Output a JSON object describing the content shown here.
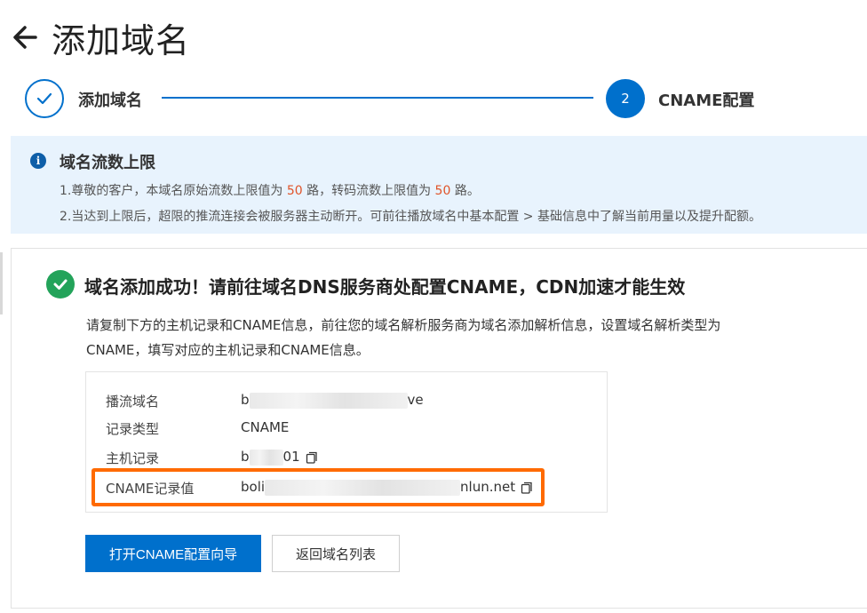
{
  "page": {
    "title": "添加域名"
  },
  "steps": [
    {
      "label": "添加域名",
      "status": "done"
    },
    {
      "number": "2",
      "label": "CNAME配置",
      "status": "active"
    }
  ],
  "notice": {
    "title": "域名流数上限",
    "line1": {
      "prefix": "1.尊敬的客户，本域名原始流数上限值为 ",
      "limit1": "50",
      "mid": " 路，转码流数上限值为 ",
      "limit2": "50",
      "suffix": " 路。"
    },
    "line2": "2.当达到上限后，超限的推流连接会被服务器主动断开。可前往播放域名中基本配置 > 基础信息中了解当前用量以及提升配额。"
  },
  "result": {
    "title": "域名添加成功！请前往域名DNS服务商处配置CNAME，CDN加速才能生效",
    "description": "请复制下方的主机记录和CNAME信息，前往您的域名解析服务商为域名添加解析信息，设置域名解析类型为CNAME，填写对应的主机记录和CNAME信息。",
    "rows": [
      {
        "label": "播流域名",
        "value_start": "b",
        "value_end": "ve"
      },
      {
        "label": "记录类型",
        "value": "CNAME"
      },
      {
        "label": "主机记录",
        "value_start": "b",
        "value_end": "01"
      },
      {
        "label": "CNAME记录值",
        "value_start": "boli",
        "value_end": "nlun.net"
      }
    ]
  },
  "buttons": {
    "primary": "打开CNAME配置向导",
    "secondary": "返回域名列表"
  },
  "colors": {
    "accent": "#0070cc",
    "success": "#23a35a",
    "limit": "#e0542a",
    "highlight_frame": "#ff6a00",
    "notice_bg": "#e8f3fd"
  }
}
